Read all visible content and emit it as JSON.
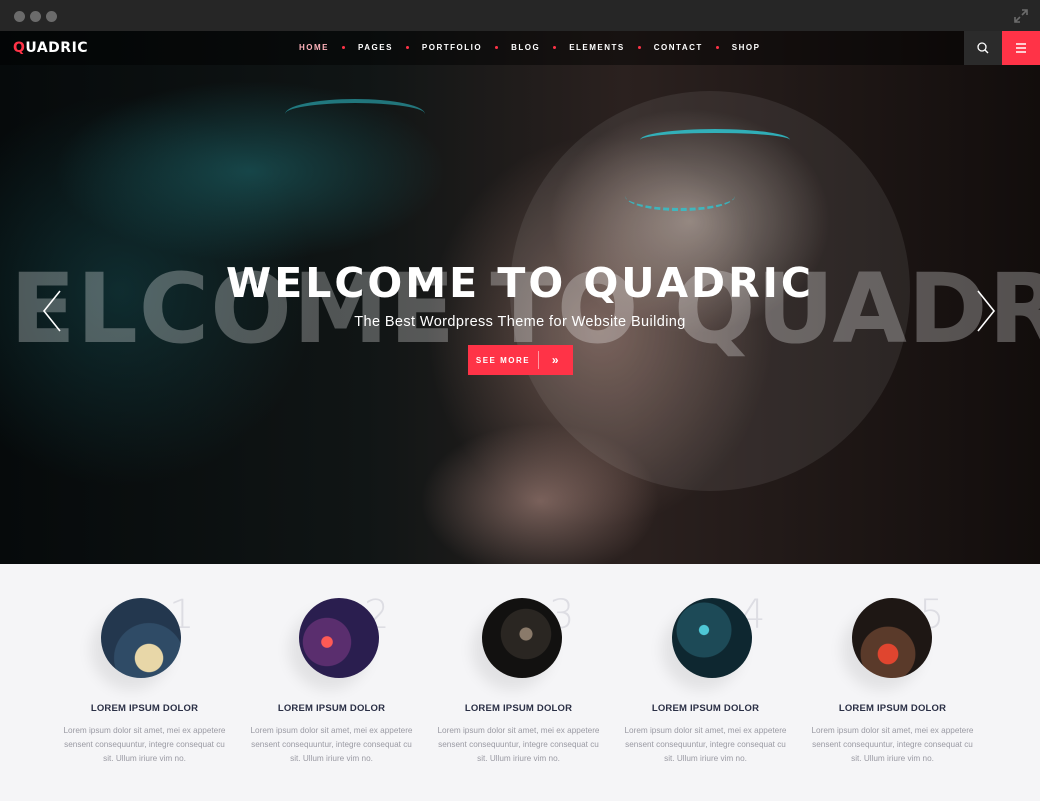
{
  "brand": {
    "first_letter": "Q",
    "rest": "UADRIC",
    "accent_color": "#ff3347"
  },
  "nav": {
    "items": [
      {
        "label": "HOME"
      },
      {
        "label": "PAGES"
      },
      {
        "label": "PORTFOLIO"
      },
      {
        "label": "BLOG"
      },
      {
        "label": "ELEMENTS"
      },
      {
        "label": "CONTACT"
      },
      {
        "label": "SHOP"
      }
    ],
    "active": "HOME",
    "search_icon": "search-icon",
    "menu_icon": "hamburger-icon"
  },
  "hero": {
    "background_word": "ELCOME TO QUADRI",
    "headline": "WELCOME TO QUADRIC",
    "subheadline": "The Best Wordpress Theme for Website Building",
    "cta_label": "SEE MORE",
    "cta_icon": "double-chevron-right-icon",
    "prev_icon": "chevron-left-icon",
    "next_icon": "chevron-right-icon"
  },
  "features": [
    {
      "number": "1",
      "title": "LOREM IPSUM DOLOR",
      "description": "Lorem ipsum dolor sit amet, mei ex appetere sensent consequuntur, integre consequat cu sit. Ullum iriure vim no."
    },
    {
      "number": "2",
      "title": "LOREM IPSUM DOLOR",
      "description": "Lorem ipsum dolor sit amet, mei ex appetere sensent consequuntur, integre consequat cu sit. Ullum iriure vim no."
    },
    {
      "number": "3",
      "title": "LOREM IPSUM DOLOR",
      "description": "Lorem ipsum dolor sit amet, mei ex appetere sensent consequuntur, integre consequat cu sit. Ullum iriure vim no."
    },
    {
      "number": "4",
      "title": "LOREM IPSUM DOLOR",
      "description": "Lorem ipsum dolor sit amet, mei ex appetere sensent consequuntur, integre consequat cu sit. Ullum iriure vim no."
    },
    {
      "number": "5",
      "title": "LOREM IPSUM DOLOR",
      "description": "Lorem ipsum dolor sit amet, mei ex appetere sensent consequuntur, integre consequat cu sit. Ullum iriure vim no."
    }
  ]
}
